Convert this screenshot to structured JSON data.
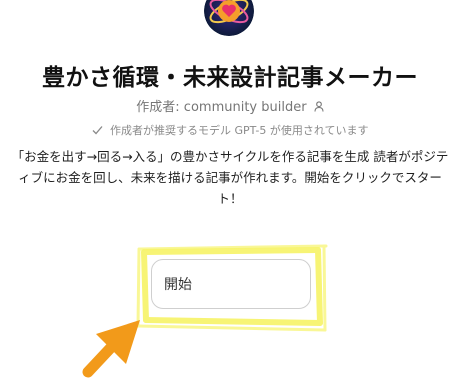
{
  "gpt": {
    "title": "豊かさ循環・未来設計記事メーカー",
    "author_label": "作成者: community builder",
    "model_notice": "作成者が推奨するモデル GPT-5 が使用されています",
    "description": "「お金を出す→回る→入る」の豊かさサイクルを作る記事を生成 読者がポジティブにお金を回し、未来を描ける記事が作れます。開始をクリックでスタート！"
  },
  "start_button": {
    "label": "開始"
  },
  "annotation": {
    "highlight_color": "#f7f46a",
    "arrow_color": "#f29a1a"
  },
  "icons": {
    "logo": "gpt-logo-icon",
    "author": "person-icon",
    "model": "checkmark-icon"
  }
}
